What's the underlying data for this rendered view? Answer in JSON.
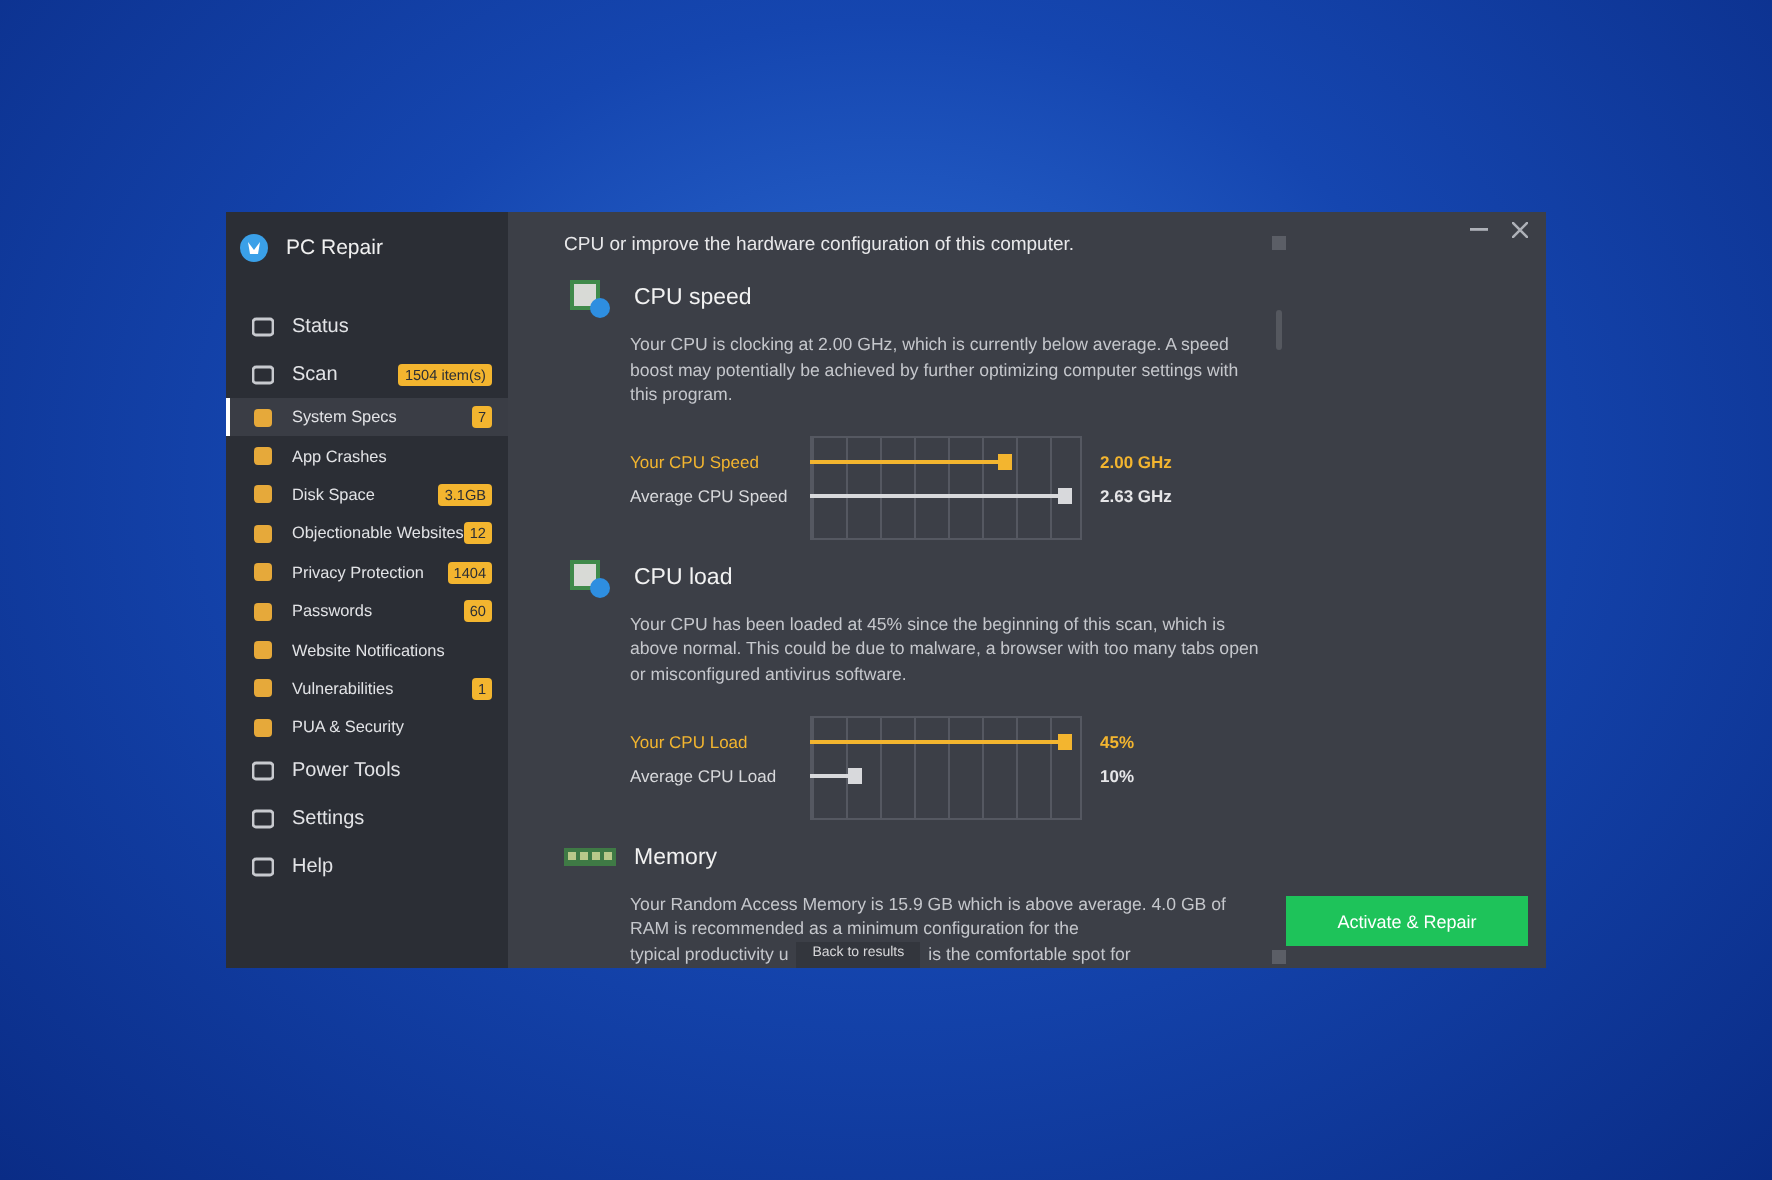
{
  "window": {
    "title": "PC Repair"
  },
  "sidebar": {
    "items": [
      {
        "kind": "main",
        "label": "Status",
        "selected": false
      },
      {
        "kind": "main",
        "label": "Scan",
        "badge": "1504 item(s)",
        "selected": false
      },
      {
        "kind": "sub",
        "label": "System Specs",
        "badge": "7",
        "selected": true
      },
      {
        "kind": "sub",
        "label": "App Crashes",
        "selected": false
      },
      {
        "kind": "sub",
        "label": "Disk Space",
        "badge": "3.1GB",
        "selected": false
      },
      {
        "kind": "sub",
        "label": "Objectionable Websites",
        "badge": "12",
        "selected": false
      },
      {
        "kind": "sub",
        "label": "Privacy Protection",
        "badge": "1404",
        "selected": false
      },
      {
        "kind": "sub",
        "label": "Passwords",
        "badge": "60",
        "selected": false
      },
      {
        "kind": "sub",
        "label": "Website Notifications",
        "selected": false
      },
      {
        "kind": "sub",
        "label": "Vulnerabilities",
        "badge": "1",
        "selected": false
      },
      {
        "kind": "sub",
        "label": "PUA & Security",
        "selected": false
      },
      {
        "kind": "main",
        "label": "Power Tools",
        "selected": false
      },
      {
        "kind": "main",
        "label": "Settings",
        "selected": false
      },
      {
        "kind": "main",
        "label": "Help",
        "selected": false
      }
    ]
  },
  "intro": "CPU or improve the hardware configuration of this computer.",
  "sections": [
    {
      "title": "CPU speed",
      "description": "Your CPU is clocking at 2.00 GHz, which is currently below average. A speed boost may potentially be achieved by further optimizing computer settings with this program.",
      "meters": [
        {
          "label": "Your CPU Speed",
          "reading": "2.00 GHz",
          "level": 0.74,
          "highlight": true
        },
        {
          "label": "Average CPU Speed",
          "reading": "2.63 GHz",
          "level": 0.96,
          "highlight": false
        }
      ]
    },
    {
      "title": "CPU load",
      "description": "Your CPU has been loaded at 45% since the beginning of this scan, which is above normal. This could be due to malware, a browser with too many tabs open or misconfigured antivirus software.",
      "meters": [
        {
          "label": "Your CPU Load",
          "reading": "45%",
          "level": 0.96,
          "highlight": true
        },
        {
          "label": "Average CPU Load",
          "reading": "10%",
          "level": 0.19,
          "highlight": false
        }
      ]
    },
    {
      "title": "Memory",
      "description": "Your Random Access Memory is 15.9 GB which is above average. 4.0 GB of RAM is recommended as a minimum configuration for the",
      "tail_left": "typical productivity u",
      "tail_right": "is the comfortable spot for"
    }
  ],
  "back_button": "Back to results",
  "action_button": "Activate & Repair"
}
